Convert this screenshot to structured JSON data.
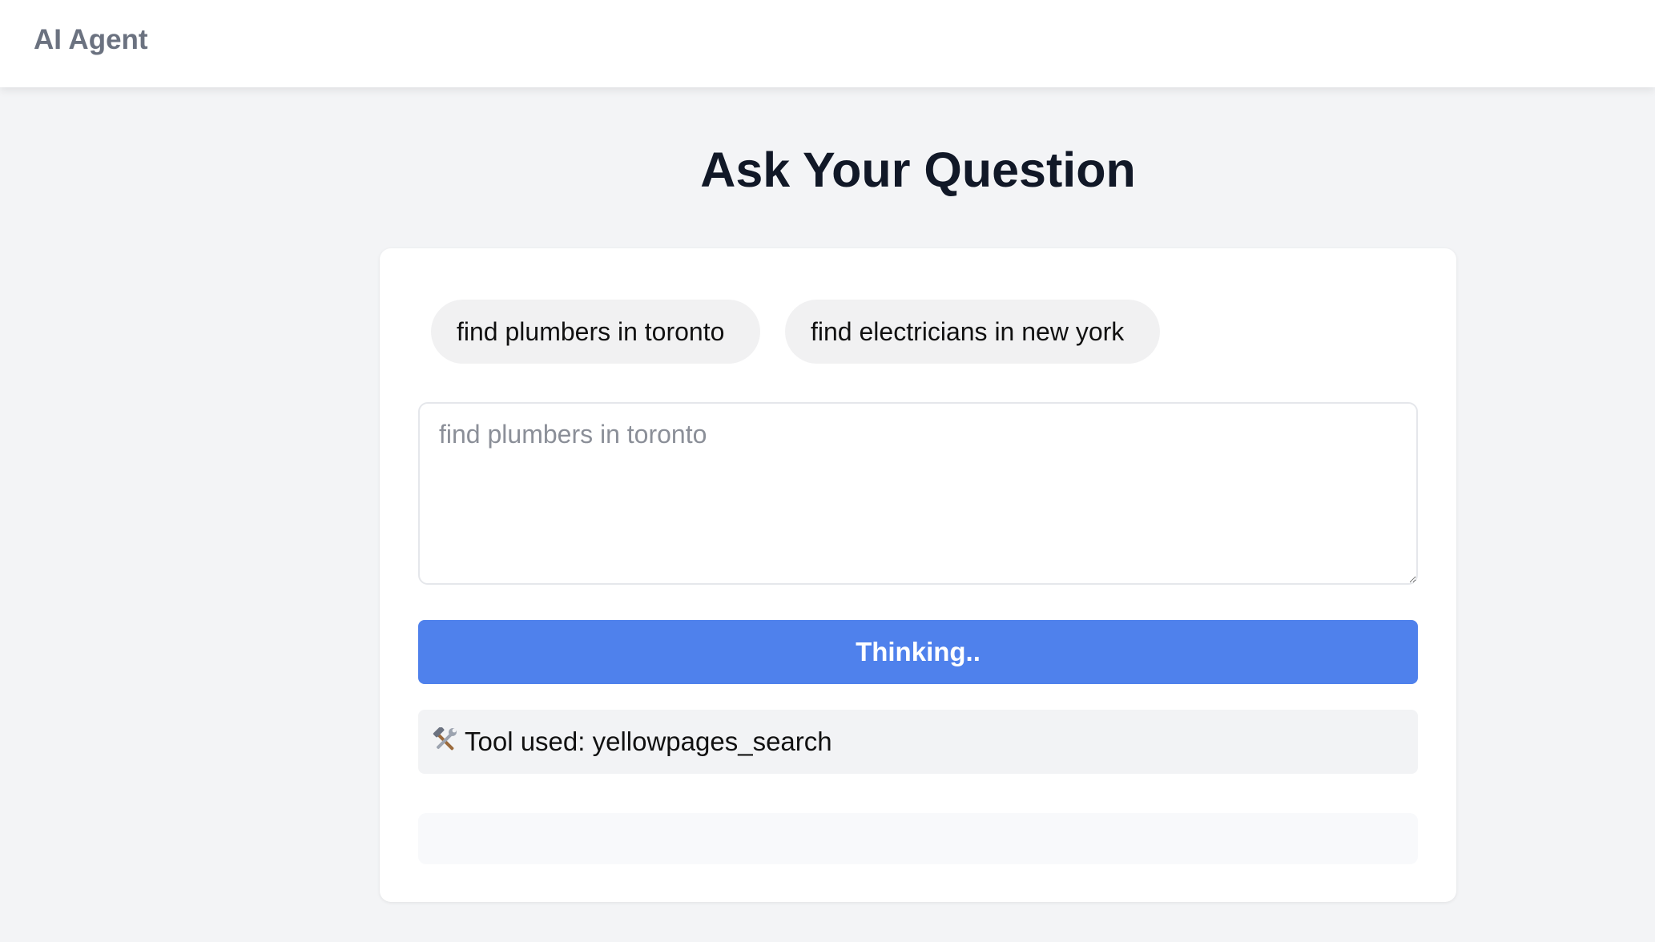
{
  "app": {
    "title": "AI Agent"
  },
  "main": {
    "heading": "Ask Your Question",
    "suggestions": [
      "find plumbers in toronto",
      "find electricians in new york"
    ],
    "input": {
      "placeholder": "find plumbers in toronto",
      "value": ""
    },
    "submit_label": "Thinking..",
    "tool_status": {
      "prefix": "Tool used:",
      "tool": "yellowpages_search",
      "icon": "hammer-and-wrench-icon"
    },
    "result": ""
  },
  "colors": {
    "accent": "#4f81ec",
    "background": "#f3f4f6",
    "card": "#ffffff"
  }
}
